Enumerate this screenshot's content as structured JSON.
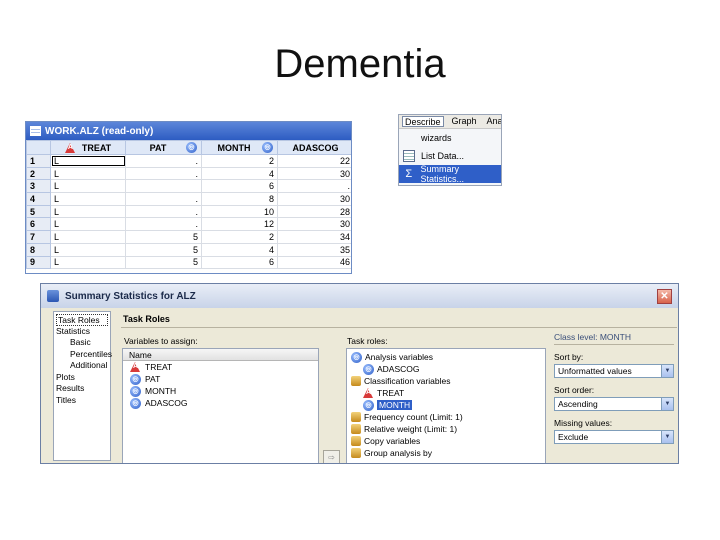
{
  "slide": {
    "title": "Dementia"
  },
  "grid": {
    "window_title": "WORK.ALZ (read-only)",
    "columns": [
      {
        "name": "TREAT",
        "type": "char"
      },
      {
        "name": "PAT",
        "type": "num"
      },
      {
        "name": "MONTH",
        "type": "num"
      },
      {
        "name": "ADASCOG",
        "type": "num"
      }
    ],
    "rows": [
      {
        "n": "1",
        "treat": "L",
        "pat": ".",
        "month": "2",
        "adascog": "22"
      },
      {
        "n": "2",
        "treat": "L",
        "pat": ".",
        "month": "4",
        "adascog": "30"
      },
      {
        "n": "3",
        "treat": "L",
        "pat": "",
        "month": "6",
        "adascog": "."
      },
      {
        "n": "4",
        "treat": "L",
        "pat": ".",
        "month": "8",
        "adascog": "30"
      },
      {
        "n": "5",
        "treat": "L",
        "pat": ".",
        "month": "10",
        "adascog": "28"
      },
      {
        "n": "6",
        "treat": "L",
        "pat": ".",
        "month": "12",
        "adascog": "30"
      },
      {
        "n": "7",
        "treat": "L",
        "pat": "5",
        "month": "2",
        "adascog": "34"
      },
      {
        "n": "8",
        "treat": "L",
        "pat": "5",
        "month": "4",
        "adascog": "35"
      },
      {
        "n": "9",
        "treat": "L",
        "pat": "5",
        "month": "6",
        "adascog": "46"
      }
    ]
  },
  "menu": {
    "bar": [
      "Describe",
      "Graph",
      "Analyze"
    ],
    "items": [
      {
        "label": "wizards",
        "icon": ""
      },
      {
        "label": "List Data...",
        "icon": "table-icon"
      },
      {
        "label": "Summary Statistics...",
        "icon": "sigma-icon"
      }
    ]
  },
  "dialog": {
    "title": "Summary Statistics for ALZ",
    "close_glyph": "✕",
    "nav": [
      {
        "label": "Task Roles",
        "level": 0,
        "selected": true
      },
      {
        "label": "Statistics",
        "level": 0
      },
      {
        "label": "Basic",
        "level": 1
      },
      {
        "label": "Percentiles",
        "level": 1
      },
      {
        "label": "Additional",
        "level": 1
      },
      {
        "label": "Plots",
        "level": 0
      },
      {
        "label": "Results",
        "level": 0
      },
      {
        "label": "Titles",
        "level": 0
      }
    ],
    "section_title": "Task Roles",
    "variables_label": "Variables to assign:",
    "variables_header": "Name",
    "variables": [
      {
        "name": "TREAT",
        "type": "char"
      },
      {
        "name": "PAT",
        "type": "num"
      },
      {
        "name": "MONTH",
        "type": "num"
      },
      {
        "name": "ADASCOG",
        "type": "num"
      }
    ],
    "arrow_button": "⇨",
    "task_roles_label": "Task roles:",
    "task_roles": [
      {
        "label": "Analysis variables",
        "child": false,
        "icon": "num"
      },
      {
        "label": "ADASCOG",
        "child": true,
        "icon": "num"
      },
      {
        "label": "Classification variables",
        "child": false,
        "icon": "grp"
      },
      {
        "label": "TREAT",
        "child": true,
        "icon": "char"
      },
      {
        "label": "MONTH",
        "child": true,
        "icon": "num",
        "selected": true
      },
      {
        "label": "Frequency count (Limit: 1)",
        "child": false,
        "icon": "grp"
      },
      {
        "label": "Relative weight (Limit: 1)",
        "child": false,
        "icon": "grp"
      },
      {
        "label": "Copy variables",
        "child": false,
        "icon": "grp"
      },
      {
        "label": "Group analysis by",
        "child": false,
        "icon": "grp"
      }
    ],
    "class_panel": {
      "title": "Class level: MONTH",
      "sort_by_label": "Sort by:",
      "sort_by_value": "Unformatted values",
      "sort_order_label": "Sort order:",
      "sort_order_value": "Ascending",
      "missing_label": "Missing values:",
      "missing_value": "Exclude"
    }
  }
}
